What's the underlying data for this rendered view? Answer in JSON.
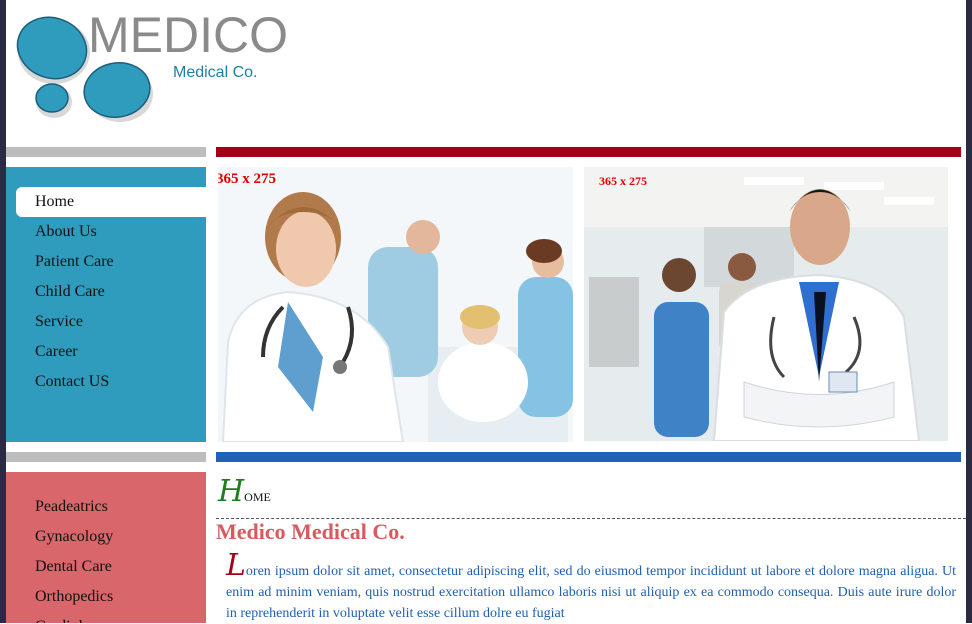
{
  "logo": {
    "title": "MEDICO",
    "subtitle": "Medical Co."
  },
  "nav": {
    "items": [
      "Home",
      "About Us",
      "Patient Care",
      "Child Care",
      "Service",
      "Career",
      "Contact US"
    ],
    "active": "Home"
  },
  "specialties": {
    "items": [
      "Peadeatrics",
      "Gynacology",
      "Dental Care",
      "Orthopedics",
      "Cardiology"
    ]
  },
  "photos": [
    {
      "label": "365 x 275"
    },
    {
      "label": "365 x 275"
    }
  ],
  "content": {
    "heading_initial": "H",
    "heading_rest": "ome",
    "company": "Medico Medical Co.",
    "para_initial": "L",
    "paragraph": "oren ipsum dolor sit amet, consectetur adipiscing elit, sed do eiusmod tempor incididunt ut labore et dolore magna aligua. Ut enim ad minim veniam, quis nostrud exercitation ullamco laboris nisi ut aliquip ex ea commodo consequa. Duis aute irure dolor in reprehenderit in voluptate velit esse cillum dolre eu fugiat"
  },
  "colors": {
    "nav_bg": "#2f9bbd",
    "specialties_bg": "#d8666a",
    "red_bar": "#a4001a",
    "blue_bar": "#1f63b8",
    "company_text": "#d65a5e",
    "paragraph_text": "#1f5fb0"
  }
}
